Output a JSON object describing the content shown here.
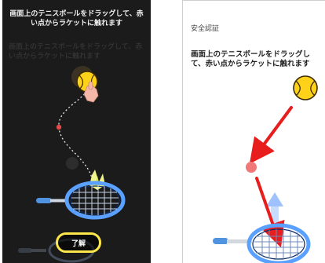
{
  "left_screen": {
    "header_text": "画面上のテニスボールをドラッグして、赤い点からラケットに触れます",
    "faded_text": "画面上のテニスボールをドラッグして、赤い点からラケットに触れます",
    "confirm_label": "了解",
    "confirm_highlight_color": "#ffe64a"
  },
  "right_screen": {
    "title": "安全認証",
    "instructions": "画面上のテニスボールをドラッグして、赤い点からラケットに触れます",
    "arrow_color": "#e81e1e",
    "dot_color": "#f07878",
    "ball_color": "#ffd21a"
  },
  "icons": {
    "tennis_ball": "tennis-ball-icon",
    "racket": "tennis-racket-icon",
    "hand_pointer": "hand-pointer-icon",
    "red_dot": "red-dot-icon",
    "arrow": "red-arrow-icon"
  }
}
